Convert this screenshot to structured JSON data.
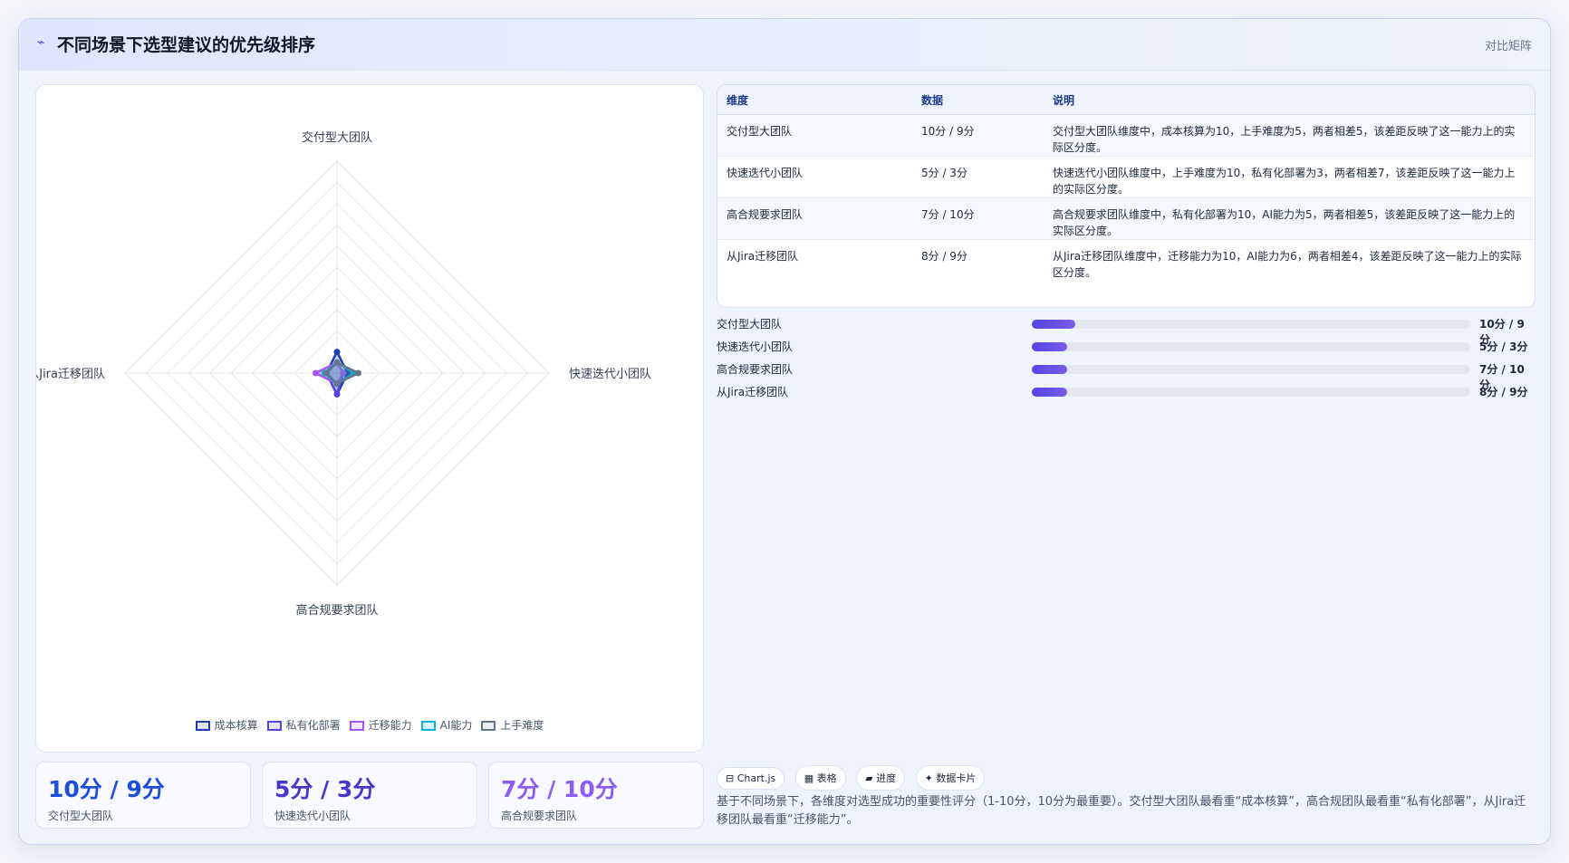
{
  "header": {
    "icon": "chart-line-icon",
    "title": "不同场景下选型建议的优先级排序",
    "tag": "对比矩阵"
  },
  "chart_data": {
    "type": "radar",
    "axes": [
      "交付型大团队",
      "快速迭代小团队",
      "高合规要求团队",
      "从Jira迁移团队"
    ],
    "rmax": 100,
    "series": [
      {
        "name": "成本核算",
        "values": [
          10,
          5,
          10,
          5
        ],
        "color": "#1e40af"
      },
      {
        "name": "私有化部署",
        "values": [
          5,
          3,
          10,
          5
        ],
        "color": "#4f46e5"
      },
      {
        "name": "迁移能力",
        "values": [
          5,
          3,
          5,
          10
        ],
        "color": "#a855f7"
      },
      {
        "name": "AI能力",
        "values": [
          5,
          8,
          5,
          6
        ],
        "color": "#06b6d4"
      },
      {
        "name": "上手难度",
        "values": [
          5,
          10,
          5,
          5
        ],
        "color": "#64748b"
      }
    ],
    "grid": true,
    "legend": "bottom"
  },
  "stats": [
    {
      "value": "10分 / 9分",
      "label": "交付型大团队",
      "color": "#1d4ed8"
    },
    {
      "value": "5分 / 3分",
      "label": "快速迭代小团队",
      "color": "#4338ca"
    },
    {
      "value": "7分 / 10分",
      "label": "高合规要求团队",
      "color": "#8b5cf6"
    }
  ],
  "table": {
    "headers": [
      "维度",
      "数据",
      "说明"
    ],
    "rows": [
      [
        "交付型大团队",
        "10分 / 9分",
        "交付型大团队维度中，成本核算为10，上手难度为5，两者相差5，该差距反映了这一能力上的实际区分度。"
      ],
      [
        "快速迭代小团队",
        "5分 / 3分",
        "快速迭代小团队维度中，上手难度为10，私有化部署为3，两者相差7，该差距反映了这一能力上的实际区分度。"
      ],
      [
        "高合规要求团队",
        "7分 / 10分",
        "高合规要求团队维度中，私有化部署为10，AI能力为5，两者相差5，该差距反映了这一能力上的实际区分度。"
      ],
      [
        "从Jira迁移团队",
        "8分 / 9分",
        "从Jira迁移团队维度中，迁移能力为10，AI能力为6，两者相差4，该差距反映了这一能力上的实际区分度。"
      ]
    ]
  },
  "bars": [
    {
      "label": "交付型大团队",
      "value": "10分 / 9分",
      "fill": 0.1
    },
    {
      "label": "快速迭代小团队",
      "value": "5分 / 3分",
      "fill": 0.08
    },
    {
      "label": "高合规要求团队",
      "value": "7分 / 10分",
      "fill": 0.08
    },
    {
      "label": "从Jira迁移团队",
      "value": "8分 / 9分",
      "fill": 0.08
    }
  ],
  "chips": [
    {
      "icon": "chart-icon",
      "glyph": "⊟",
      "label": "Chart.js"
    },
    {
      "icon": "table-icon",
      "glyph": "▦",
      "label": "表格"
    },
    {
      "icon": "progress-icon",
      "glyph": "▰",
      "label": "进度"
    },
    {
      "icon": "data-card-icon",
      "glyph": "✦",
      "label": "数据卡片"
    }
  ],
  "note": "基于不同场景下，各维度对选型成功的重要性评分（1-10分，10分为最重要）。交付型大团队最看重“成本核算”，高合规团队最看重“私有化部署”，从Jira迁移团队最看重“迁移能力”。"
}
